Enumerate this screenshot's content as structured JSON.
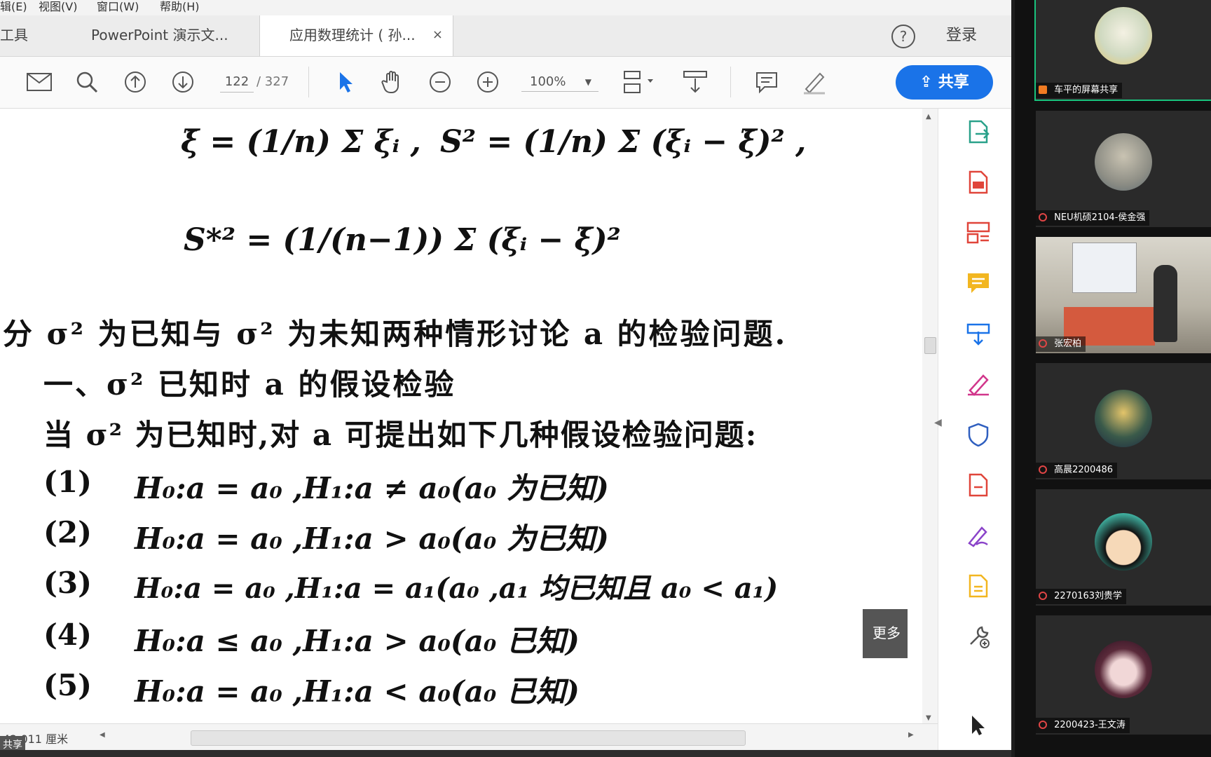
{
  "menu": [
    "辑(E)",
    "视图(V)",
    "窗口(W)",
    "帮助(H)"
  ],
  "tabs": [
    {
      "label": "工具"
    },
    {
      "label": "PowerPoint 演示文..."
    },
    {
      "label": "应用数理统计 ( 孙...",
      "close": "×"
    }
  ],
  "header_right": {
    "help": "?",
    "login": "登录"
  },
  "toolbar": {
    "page_current": "122",
    "page_total": "/ 327",
    "zoom": "100%",
    "share_label": "共享"
  },
  "document": {
    "formula1_left": "ξ̄ = (1/n) Σ ξᵢ ,",
    "formula1_right": "S² = (1/n) Σ (ξᵢ − ξ̄)² ,",
    "formula2": "S*² = (1/(n−1)) Σ (ξᵢ − ξ̄)²",
    "para1": "分 σ² 为已知与 σ² 为未知两种情形讨论 a 的检验问题.",
    "section_title": "一、σ² 已知时 a 的假设检验",
    "para2": "当 σ² 为已知时,对 a 可提出如下几种假设检验问题:",
    "items": [
      {
        "num": "(1)",
        "text": "H₀:a = a₀ ,H₁:a ≠ a₀(a₀ 为已知)"
      },
      {
        "num": "(2)",
        "text": "H₀:a = a₀ ,H₁:a > a₀(a₀ 为已知)"
      },
      {
        "num": "(3)",
        "text": "H₀:a = a₀ ,H₁:a = a₁(a₀ ,a₁ 均已知且 a₀ < a₁)"
      },
      {
        "num": "(4)",
        "text": "H₀:a ≤ a₀ ,H₁:a > a₀(a₀ 已知)"
      },
      {
        "num": "(5)",
        "text": "H₀:a = a₀ ,H₁:a < a₀(a₀ 已知)"
      }
    ]
  },
  "status": {
    "size": "42.011 厘米",
    "share_badge": "共享"
  },
  "tooltip": "更多",
  "participants": [
    {
      "name": "车平的屏幕共享",
      "avatar_color": "#cfd9c0"
    },
    {
      "name": "NEU机硕2104-侯金强",
      "avatar_color": "#8f8f86"
    },
    {
      "name": "张宏柏",
      "avatar_color": "#d9d6cc"
    },
    {
      "name": "高晨2200486",
      "avatar_color": "#3a5a4a"
    },
    {
      "name": "2270163刘贵学",
      "avatar_color": "#3fae9e"
    },
    {
      "name": "2200423-王文涛",
      "avatar_color": "#5a2a3a"
    }
  ]
}
